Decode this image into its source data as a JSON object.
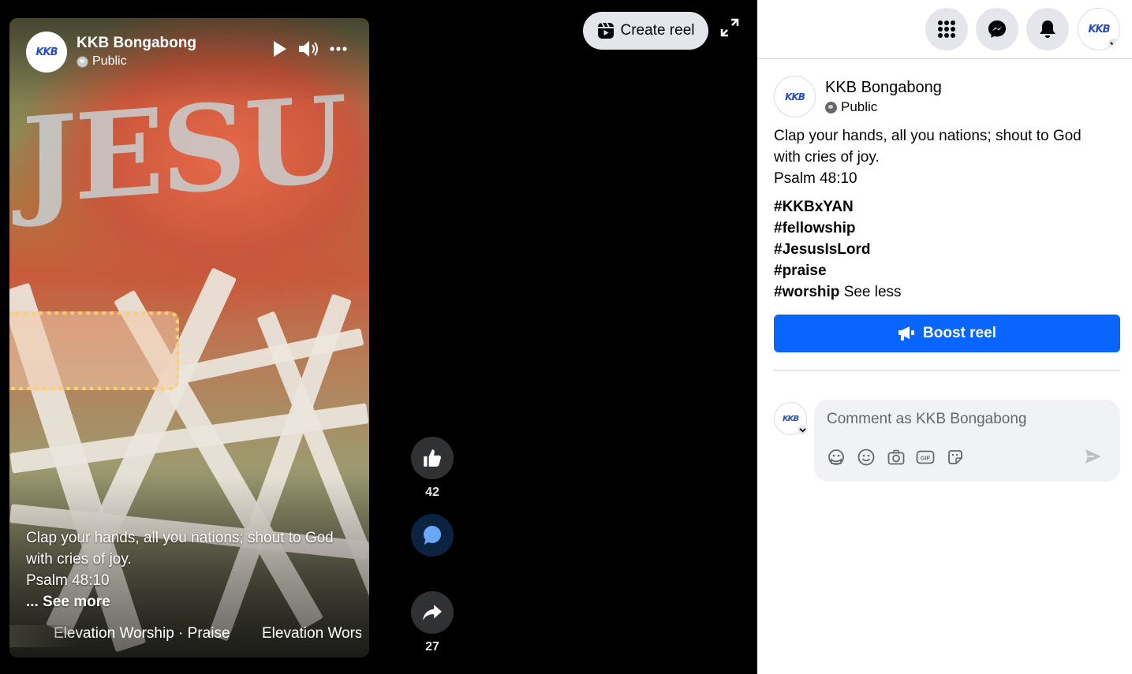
{
  "video": {
    "author": "KKB Bongabong",
    "privacy": "Public",
    "avatar_text": "KKB",
    "caption_lines": [
      "Clap your hands, all you nations; shout to God",
      "with cries of joy.",
      "Psalm 48:10"
    ],
    "see_more": "... See more",
    "music_1": "Elevation Worship · Praise",
    "music_2": "Elevation Wors"
  },
  "actions": {
    "like_count": "42",
    "share_count": "27"
  },
  "create_reel_label": "Create reel",
  "post": {
    "author": "KKB Bongabong",
    "privacy": "Public",
    "avatar_text": "KKB",
    "caption_lines": [
      "Clap your hands, all you nations; shout to God",
      "with cries of joy.",
      "Psalm 48:10"
    ],
    "hashtags": [
      "#KKBxYAN",
      "#fellowship",
      "#JesusIsLord",
      "#praise",
      "#worship"
    ],
    "see_less": "See less",
    "boost_label": "Boost reel"
  },
  "comment": {
    "placeholder": "Comment as KKB Bongabong",
    "avatar_text": "KKB"
  },
  "colors": {
    "accent": "#0866ff",
    "panel_bg": "#ffffff",
    "stage_bg": "#000000"
  },
  "icons": [
    "menu-grid-icon",
    "messenger-icon",
    "bell-icon",
    "reel-icon",
    "expand-icon",
    "play-icon",
    "volume-icon",
    "more-icon",
    "like-icon",
    "comment-icon",
    "share-icon",
    "megaphone-icon",
    "avatar-sticker-icon",
    "emoji-icon",
    "camera-icon",
    "gif-icon",
    "sticker-icon",
    "send-icon"
  ]
}
